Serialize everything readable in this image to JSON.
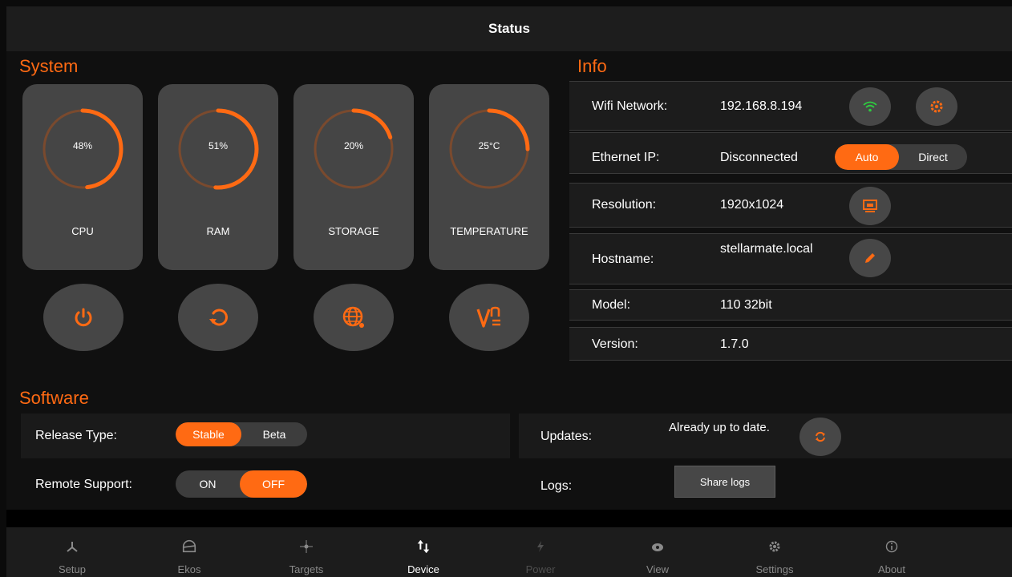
{
  "header": {
    "title": "Status"
  },
  "system": {
    "title": "System",
    "gauges": [
      {
        "label": "CPU",
        "value_text": "48%",
        "fraction": 0.48
      },
      {
        "label": "RAM",
        "value_text": "51%",
        "fraction": 0.51
      },
      {
        "label": "STORAGE",
        "value_text": "20%",
        "fraction": 0.2
      },
      {
        "label": "TEMPERATURE",
        "value_text": "25°C",
        "fraction": 0.25
      }
    ],
    "actions": [
      "power-icon",
      "restart-icon",
      "web-icon",
      "vnc-icon"
    ]
  },
  "info": {
    "title": "Info",
    "wifi": {
      "label": "Wifi Network:",
      "value": "192.168.8.194"
    },
    "ethernet": {
      "label": "Ethernet IP:",
      "value": "Disconnected",
      "options": [
        "Auto",
        "Direct"
      ],
      "selected": "Auto"
    },
    "resolution": {
      "label": "Resolution:",
      "value": "1920x1024"
    },
    "hostname": {
      "label": "Hostname:",
      "value": "stellarmate.local"
    },
    "model": {
      "label": "Model:",
      "value": "110 32bit"
    },
    "version": {
      "label": "Version:",
      "value": "1.7.0"
    }
  },
  "software": {
    "title": "Software",
    "release": {
      "label": "Release Type:",
      "options": [
        "Stable",
        "Beta"
      ],
      "selected": "Stable"
    },
    "remote": {
      "label": "Remote Support:",
      "options": [
        "ON",
        "OFF"
      ],
      "selected": "OFF"
    },
    "updates": {
      "label": "Updates:",
      "status": "Already up to date."
    },
    "logs": {
      "label": "Logs:",
      "button": "Share logs"
    }
  },
  "nav": {
    "items": [
      {
        "label": "Setup",
        "icon": "setup-icon"
      },
      {
        "label": "Ekos",
        "icon": "ekos-icon"
      },
      {
        "label": "Targets",
        "icon": "targets-icon"
      },
      {
        "label": "Device",
        "icon": "device-icon"
      },
      {
        "label": "Power",
        "icon": "power-icon"
      },
      {
        "label": "View",
        "icon": "view-icon"
      },
      {
        "label": "Settings",
        "icon": "settings-icon"
      },
      {
        "label": "About",
        "icon": "about-icon"
      }
    ],
    "active": "Device"
  },
  "colors": {
    "accent": "#ff6a13",
    "panel": "#454545",
    "background": "#101010",
    "wifi": "#2ecc40"
  }
}
